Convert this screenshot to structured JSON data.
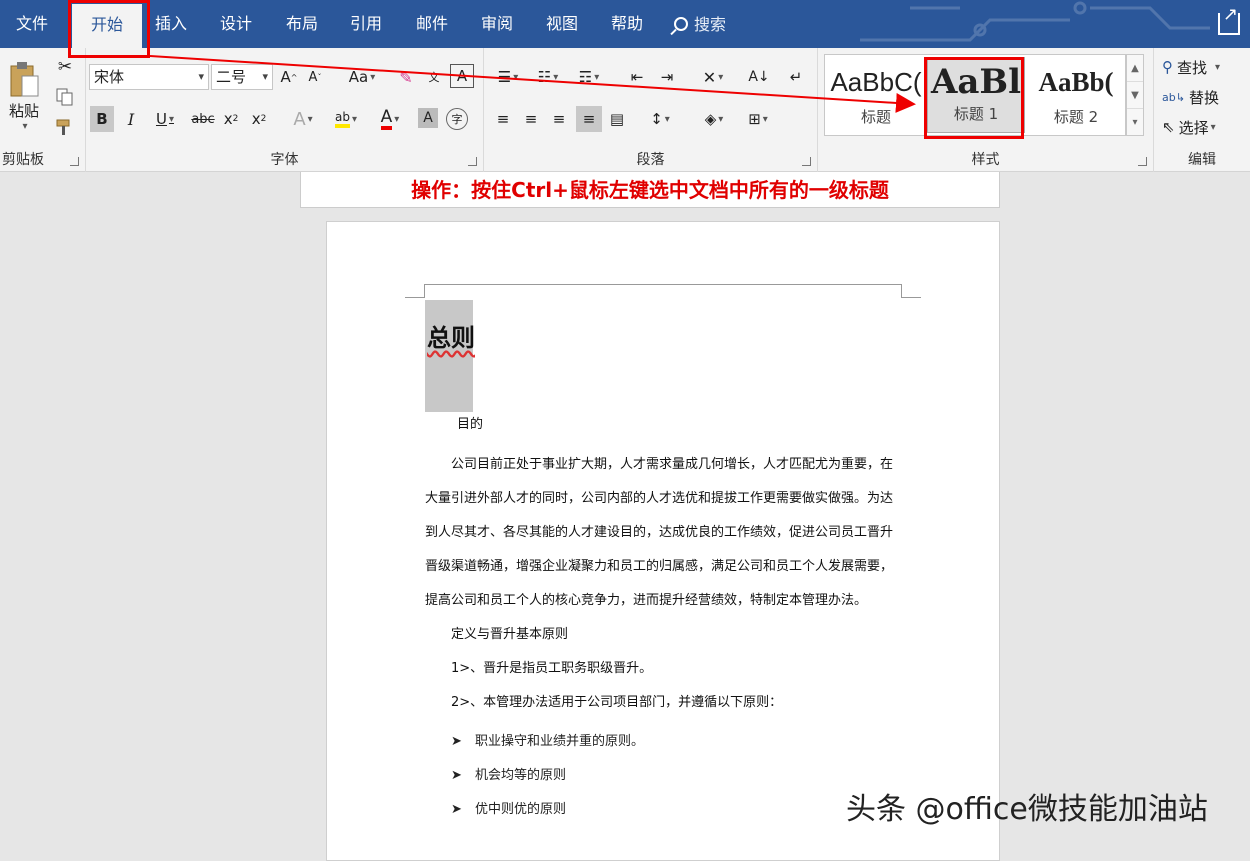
{
  "tabs": [
    "文件",
    "开始",
    "插入",
    "设计",
    "布局",
    "引用",
    "邮件",
    "审阅",
    "视图",
    "帮助"
  ],
  "active_tab": "开始",
  "search_tab": "搜索",
  "clipboard": {
    "paste_label": "粘贴",
    "group_label": "剪贴板"
  },
  "font": {
    "font_name": "宋体",
    "font_size": "二号",
    "aa_label": "Aa",
    "group_label": "字体"
  },
  "paragraph": {
    "group_label": "段落"
  },
  "styles": {
    "items": [
      {
        "sample": "AaBbC(",
        "name": "标题"
      },
      {
        "sample": "AaBl",
        "name": "标题 1"
      },
      {
        "sample": "AaBb(",
        "name": "标题 2"
      }
    ],
    "group_label": "样式"
  },
  "editing": {
    "find": "查找",
    "replace": "替换",
    "select": "选择",
    "group_label": "编辑"
  },
  "instruction": "操作：按住Ctrl+鼠标左键选中文档中所有的一级标题",
  "document": {
    "heading1": "总则",
    "heading2": "目的",
    "paragraph_lines": [
      "公司目前正处于事业扩大期，人才需求量成几何增长，人才匹配尤为重要，在",
      "大量引进外部人才的同时，公司内部的人才选优和提拔工作更需要做实做强。为达",
      "到人尽其才、各尽其能的人才建设目的，达成优良的工作绩效，促进公司员工晋升",
      "晋级渠道畅通，增强企业凝聚力和员工的归属感，满足公司和员工个人发展需要，",
      "提高公司和员工个人的核心竞争力，进而提升经营绩效，特制定本管理办法。"
    ],
    "heading2b": "定义与晋升基本原则",
    "items": [
      "1>、晋升是指员工职务职级晋升。",
      "2>、本管理办法适用于公司项目部门，并遵循以下原则："
    ],
    "bullets": [
      "职业操守和业绩并重的原则。",
      "机会均等的原则",
      "优中则优的原则"
    ]
  },
  "watermark": "头条 @office微技能加油站",
  "colors": {
    "titlebar": "#2b579a",
    "annotation": "#e00000"
  }
}
